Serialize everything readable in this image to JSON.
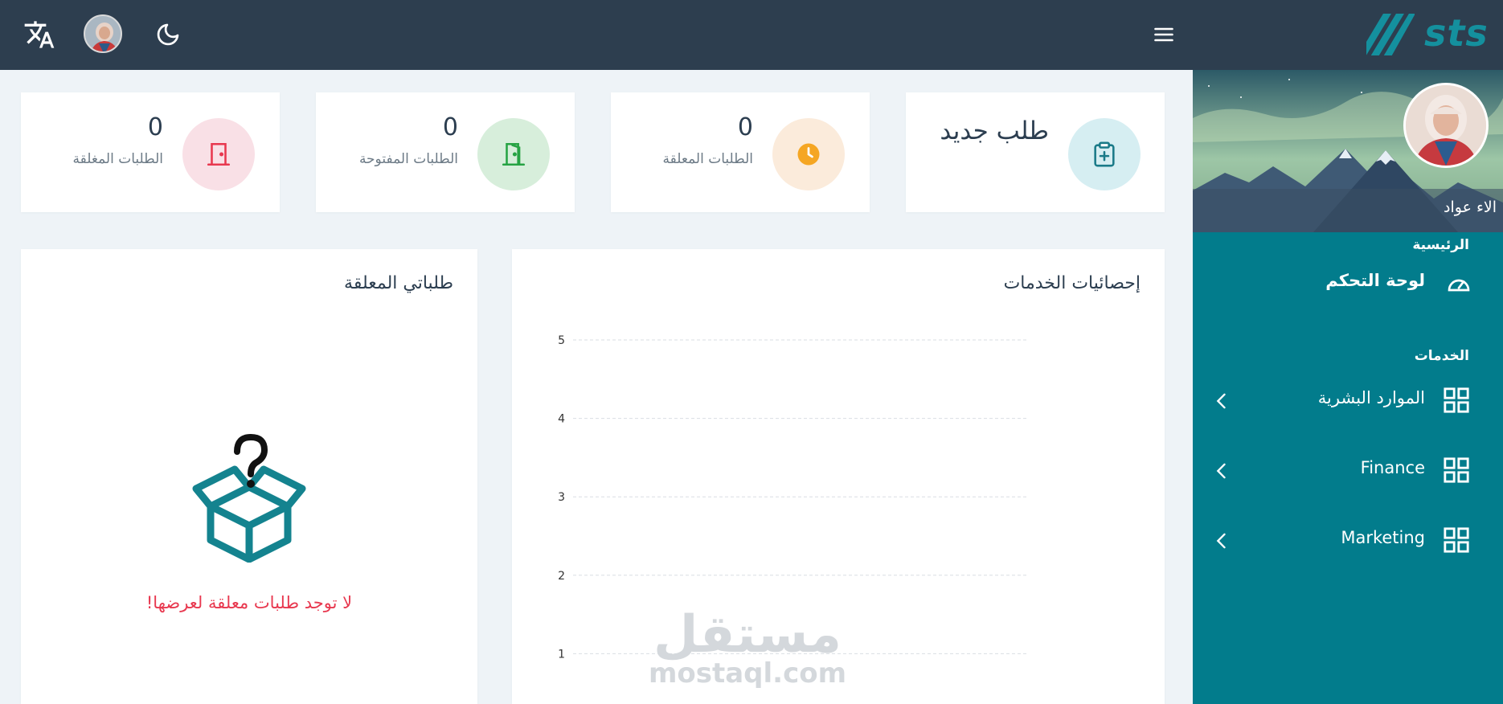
{
  "app": {
    "logo_text": "sts",
    "brand_color": "#14909e"
  },
  "topbar": {
    "icons": [
      "translate-icon",
      "user-avatar",
      "moon-icon",
      "menu-icon"
    ]
  },
  "sidebar": {
    "user_name": "الاء عواد",
    "section_main": "الرئيسية",
    "dashboard_label": "لوحة التحكم",
    "section_services": "الخدمات",
    "items": [
      {
        "label": "الموارد البشرية"
      },
      {
        "label": "Finance"
      },
      {
        "label": "Marketing"
      }
    ]
  },
  "stats": {
    "new_request": {
      "label": "طلب جديد",
      "color": "#d6eef2"
    },
    "pending": {
      "count": "0",
      "label": "الطلبات المعلقة",
      "color": "#fbebdb"
    },
    "open": {
      "count": "0",
      "label": "الطلبات المفتوحة",
      "color": "#d7eedb"
    },
    "closed": {
      "count": "0",
      "label": "الطلبات المغلقة",
      "color": "#f9e0e6"
    }
  },
  "services_chart": {
    "title": "إحصائيات الخدمات"
  },
  "chart_data": {
    "type": "bar",
    "title": "إحصائيات الخدمات",
    "categories": [],
    "values": [],
    "y_ticks": [
      "5",
      "4",
      "3",
      "2",
      "1"
    ],
    "ylim": [
      0,
      5
    ],
    "grid": true
  },
  "pending_panel": {
    "title": "طلباتي المعلقة",
    "empty_message": "لا توجد طلبات معلقة لعرضها!"
  },
  "watermark": {
    "arabic": "مستقل",
    "latin": "mostaql.com"
  }
}
